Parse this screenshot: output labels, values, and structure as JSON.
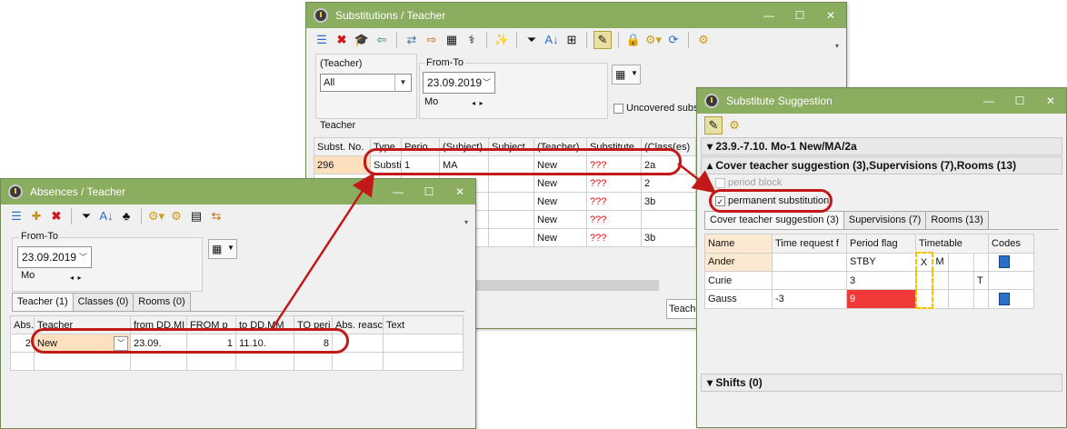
{
  "substitutions": {
    "title": "Substitutions / Teacher",
    "teacher_label": "(Teacher)",
    "teacher_value": "All",
    "fromto_label": "From-To",
    "date": "23.09.2019",
    "weekday": "Mo",
    "uncovered_label": "Uncovered subs",
    "teacher_caption": "Teacher",
    "footer_label": "Teache",
    "columns": [
      "Subst. No.",
      "Type",
      "Perio",
      "(Subject)",
      "Subject",
      "(Teacher)",
      "Substitute",
      "(Class(es)"
    ],
    "rows": [
      [
        "296",
        "Substi",
        "1",
        "MA",
        "",
        "New",
        "???",
        "2a"
      ],
      [
        "",
        "",
        "",
        "",
        "",
        "New",
        "???",
        "2"
      ],
      [
        "",
        "",
        "",
        "",
        "",
        "New",
        "???",
        "3b"
      ],
      [
        "",
        "",
        "",
        "",
        "",
        "New",
        "???",
        ""
      ],
      [
        "",
        "",
        "",
        "",
        "",
        "New",
        "???",
        "3b"
      ]
    ]
  },
  "absences": {
    "title": "Absences / Teacher",
    "fromto_label": "From-To",
    "date": "23.09.2019",
    "weekday": "Mo",
    "tabs": [
      "Teacher (1)",
      "Classes (0)",
      "Rooms (0)"
    ],
    "columns": [
      "Abs.",
      "Teacher",
      "from DD.MI",
      "FROM p",
      "to DD.MM",
      "TO peri",
      "Abs. reasc",
      "Text"
    ],
    "row": [
      "2",
      "New",
      "23.09.",
      "1",
      "11.10.",
      "8",
      "",
      ""
    ]
  },
  "suggestion": {
    "title": "Substitute Suggestion",
    "header1": "23.9.-7.10. Mo-1 New/MA/2a",
    "header2": "Cover teacher suggestion (3),Supervisions (7),Rooms (13)",
    "period_block": "period block",
    "permanent": "permanent substitution",
    "tabs": [
      "Cover teacher suggestion (3)",
      "Supervisions (7)",
      "Rooms (13)"
    ],
    "columns": [
      "Name",
      "Time request f",
      "Period flag",
      "Timetable",
      "Codes"
    ],
    "rows": [
      {
        "name": "Ander",
        "time": "",
        "flag": "STBY",
        "t1": "X",
        "t2": "M",
        "t3": "",
        "t4": ""
      },
      {
        "name": "Curie",
        "time": "",
        "flag": "3",
        "t1": "",
        "t2": "",
        "t3": "",
        "t4": "T"
      },
      {
        "name": "Gauss",
        "time": "-3",
        "flag": "9",
        "t1": "",
        "t2": "",
        "t3": "",
        "t4": ""
      }
    ],
    "shifts": "Shifts (0)"
  },
  "colors": {
    "titlebar": "#8aad5f",
    "highlight": "#c21818",
    "selected_row": "#fde0bd",
    "flag_red": "#f03a3a",
    "timetable_yellow": "#f5c400"
  }
}
